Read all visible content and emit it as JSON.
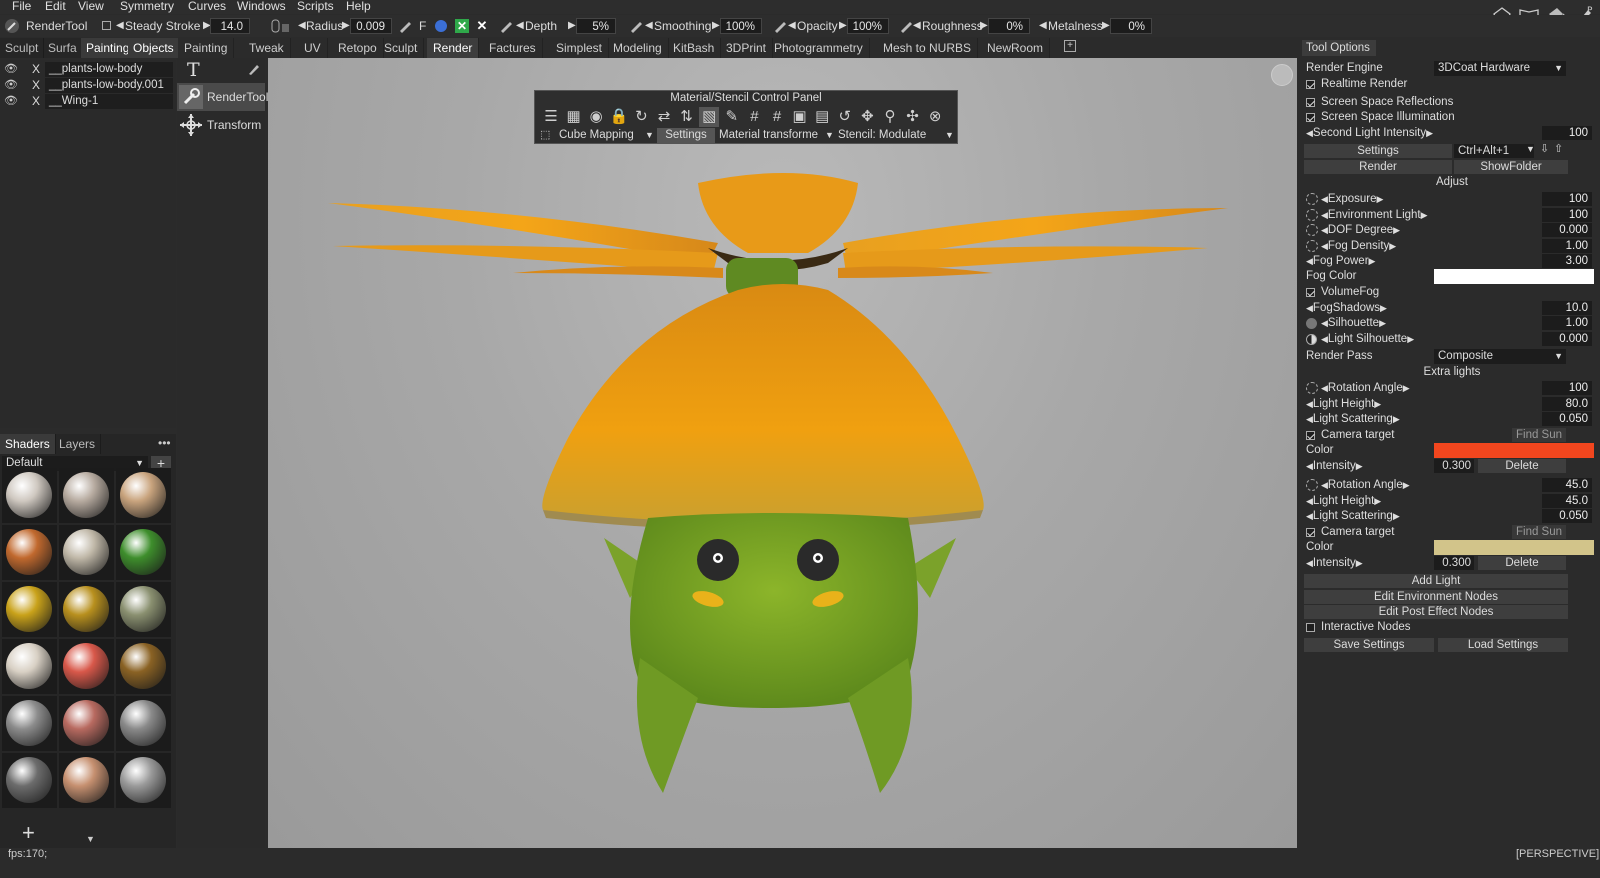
{
  "menu": [
    "File",
    "Edit",
    "View",
    "Symmetry",
    "Curves",
    "Windows",
    "Scripts",
    "Help"
  ],
  "toolbar": {
    "tool_name": "RenderTool",
    "steady_stroke_label": "Steady  Stroke",
    "steady_stroke_value": "14.0",
    "radius_label": "Radius",
    "radius_value": "0.009",
    "f_label": "F",
    "depth_label": "Depth",
    "depth_value": "5%",
    "smoothing_label": "Smoothing",
    "smoothing_value": "100%",
    "opacity_label": "Opacity",
    "opacity_value": "100%",
    "roughness_label": "Roughness",
    "roughness_value": "0%",
    "metalness_label": "Metalness",
    "metalness_value": "0%"
  },
  "rooms": [
    "Painting",
    "Tweak",
    "UV",
    "Retopo",
    "Sculpt",
    "Render",
    "Factures",
    "Simplest",
    "Modeling",
    "KitBash",
    "3DPrint",
    "Photogrammetry",
    "Mesh  to  NURBS",
    "NewRoom"
  ],
  "active_room": "Render",
  "left_tabs": [
    "Sculpt",
    "Surfa",
    "Painting",
    "Objects"
  ],
  "objects": [
    "__plants-low-body",
    "__plants-low-body.001",
    "__Wing-1"
  ],
  "shader_tabs": [
    "Shaders",
    "Layers"
  ],
  "shader_preset": "Default",
  "shader_colors": [
    "#cfc8c0",
    "#b7aba0",
    "#c9a47e",
    "#c1692e",
    "#c0b8a8",
    "#3e8e2c",
    "#c9a21a",
    "#b8901e",
    "#8a9070",
    "#d8d0c4",
    "#d8584a",
    "#8a6224",
    "#8c8c8c",
    "#b86a60",
    "#8a8a8a",
    "#6c6c6c",
    "#c69070",
    "#9a9a9a"
  ],
  "tools": [
    {
      "icon": "text-icon",
      "label": ""
    },
    {
      "icon": "wrench-icon",
      "label": "RenderTool"
    },
    {
      "icon": "transform-icon",
      "label": "Transform"
    }
  ],
  "material_panel": {
    "title": "Material/Stencil  Control  Panel",
    "mapping": "Cube  Mapping",
    "settings": "Settings",
    "material_transform": "Material  transforme",
    "stencil": "Stencil:  Modulate"
  },
  "right_panel": {
    "tab": "Tool  Options",
    "render_engine_label": "Render  Engine",
    "render_engine_value": "3DCoat Hardware",
    "realtime_render": "Realtime  Render",
    "ssr": "Screen  Space  Reflections",
    "ssi": "Screen  Space  Illumination",
    "second_light_label": "Second  Light  Intensity",
    "second_light_value": "100",
    "settings_btn": "Settings",
    "hotkey": "Ctrl+Alt+1",
    "render_btn": "Render",
    "showfolder_btn": "ShowFolder",
    "adjust_header": "Adjust",
    "adjust": [
      {
        "label": "Exposure",
        "value": "100"
      },
      {
        "label": "Environment  Light",
        "value": "100"
      },
      {
        "label": "DOF  Degree",
        "value": "0.000"
      },
      {
        "label": "Fog  Density",
        "value": "1.00"
      },
      {
        "label": "Fog  Power",
        "value": "3.00"
      }
    ],
    "fog_color_label": "Fog  Color",
    "fog_color": "#ffffff",
    "volumefog": "VolumeFog",
    "fogshadows_label": "FogShadows",
    "fogshadows_value": "10.0",
    "silhouette_label": "Silhouette",
    "silhouette_value": "1.00",
    "light_silhouette_label": "Light  Silhouette",
    "light_silhouette_value": "0.000",
    "render_pass_label": "Render  Pass",
    "render_pass_value": "Composite",
    "extra_lights_header": "Extra  lights",
    "lights": [
      {
        "rotation_label": "Rotation  Angle",
        "rotation": "100",
        "height_label": "Light  Height",
        "height": "80.0",
        "scatter_label": "Light  Scattering",
        "scatter": "0.050",
        "camera_target": "Camera  target",
        "find_sun": "Find  Sun",
        "color_label": "Color",
        "color": "#f2461e",
        "intensity_label": "Intensity",
        "intensity": "0.300",
        "delete": "Delete"
      },
      {
        "rotation_label": "Rotation  Angle",
        "rotation": "45.0",
        "height_label": "Light  Height",
        "height": "45.0",
        "scatter_label": "Light  Scattering",
        "scatter": "0.050",
        "camera_target": "Camera  target",
        "find_sun": "Find  Sun",
        "color_label": "Color",
        "color": "#d2c48a",
        "intensity_label": "Intensity",
        "intensity": "0.300",
        "delete": "Delete"
      }
    ],
    "add_light": "Add  Light",
    "edit_env_nodes": "Edit  Environment  Nodes",
    "edit_post_nodes": "Edit  Post  Effect  Nodes",
    "interactive_nodes": "Interactive  Nodes",
    "save_settings": "Save  Settings",
    "load_settings": "Load  Settings"
  },
  "status": {
    "fps": "fps:170;",
    "view": "[PERSPECTIVE]"
  }
}
